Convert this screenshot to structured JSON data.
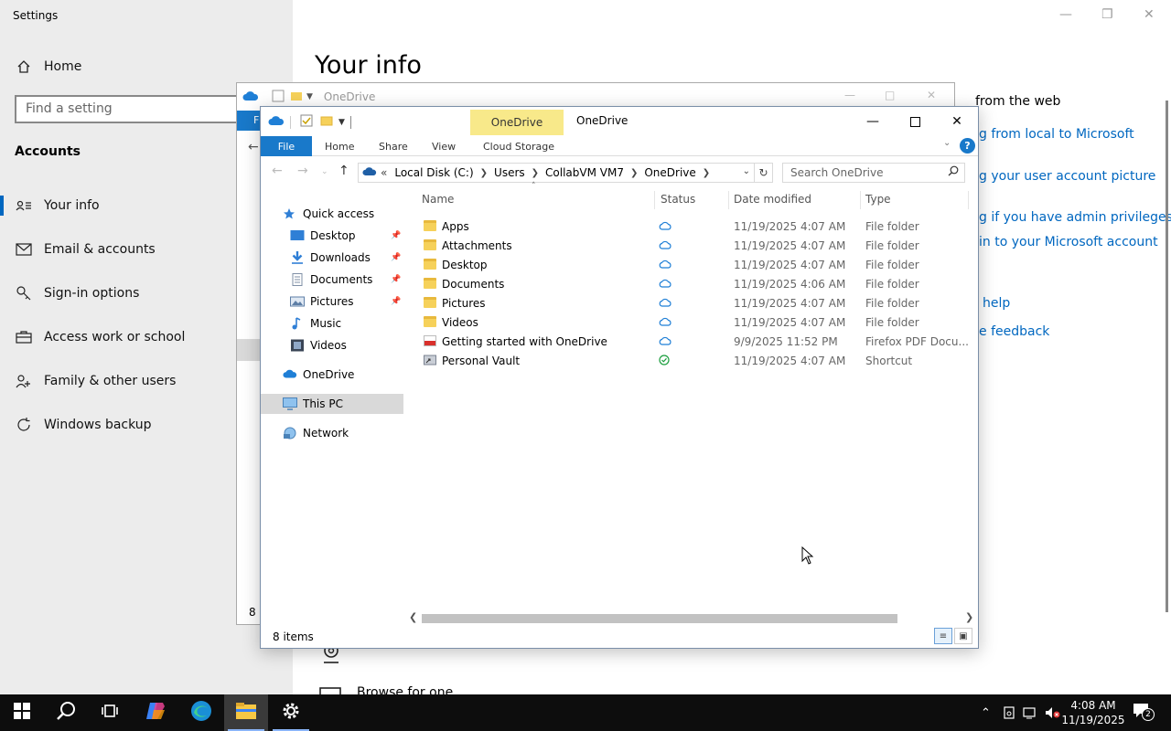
{
  "settings": {
    "title": "Settings",
    "nav_home": "Home",
    "search_placeholder": "Find a setting",
    "section": "Accounts",
    "nav": [
      "Your info",
      "Email & accounts",
      "Sign-in options",
      "Access work or school",
      "Family & other users",
      "Windows backup"
    ],
    "page_title": "Your info",
    "right_text_top": "from the web",
    "links": [
      "g from local to Microsoft",
      "g your user account picture",
      "g if you have admin privileges",
      "in to your Microsoft account",
      "help",
      "e feedback"
    ],
    "bottom_text": "Browse for one"
  },
  "back_window": {
    "title": "OneDrive",
    "status_fragment": "8 i"
  },
  "explorer": {
    "context_tab": "OneDrive",
    "title": "OneDrive",
    "tabs": [
      "File",
      "Home",
      "Share",
      "View",
      "Cloud Storage"
    ],
    "address": [
      "Local Disk (C:)",
      "Users",
      "CollabVM VM7",
      "OneDrive"
    ],
    "address_prefix": "«",
    "search_placeholder": "Search OneDrive",
    "nav": {
      "quick_access": "Quick access",
      "desktop": "Desktop",
      "downloads": "Downloads",
      "documents": "Documents",
      "pictures": "Pictures",
      "music": "Music",
      "videos": "Videos",
      "onedrive": "OneDrive",
      "this_pc": "This PC",
      "network": "Network"
    },
    "columns": [
      "Name",
      "Status",
      "Date modified",
      "Type"
    ],
    "rows": [
      {
        "name": "Apps",
        "date": "11/19/2025 4:07 AM",
        "type": "File folder",
        "kind": "folder",
        "status": "cloud"
      },
      {
        "name": "Attachments",
        "date": "11/19/2025 4:07 AM",
        "type": "File folder",
        "kind": "folder",
        "status": "cloud"
      },
      {
        "name": "Desktop",
        "date": "11/19/2025 4:07 AM",
        "type": "File folder",
        "kind": "folder",
        "status": "cloud"
      },
      {
        "name": "Documents",
        "date": "11/19/2025 4:06 AM",
        "type": "File folder",
        "kind": "folder",
        "status": "cloud"
      },
      {
        "name": "Pictures",
        "date": "11/19/2025 4:07 AM",
        "type": "File folder",
        "kind": "folder",
        "status": "cloud"
      },
      {
        "name": "Videos",
        "date": "11/19/2025 4:07 AM",
        "type": "File folder",
        "kind": "folder",
        "status": "cloud"
      },
      {
        "name": "Getting started with OneDrive",
        "date": "9/9/2025 11:52 PM",
        "type": "Firefox PDF Docu...",
        "kind": "pdf",
        "status": "cloud"
      },
      {
        "name": "Personal Vault",
        "date": "11/19/2025 4:07 AM",
        "type": "Shortcut",
        "kind": "shortcut",
        "status": "synced"
      }
    ],
    "item_count": "8 items"
  },
  "taskbar": {
    "time": "4:08 AM",
    "date": "11/19/2025",
    "notification_count": "2"
  },
  "colors": {
    "accent": "#0067c0",
    "file_tab": "#1979ca",
    "context_tab": "#f8e98a",
    "folder": "#f6d15a",
    "cloud": "#1f7fd6",
    "synced": "#1b9e3e"
  }
}
